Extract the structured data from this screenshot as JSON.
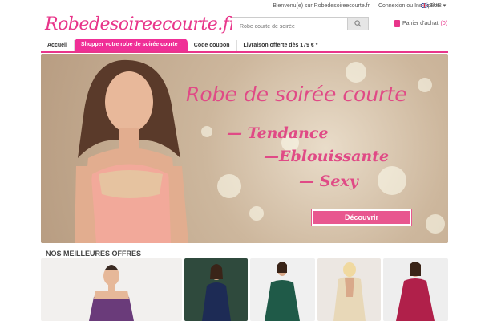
{
  "header": {
    "welcome_link": "Bienvenu(e) sur Robedesoireecourte.fr",
    "login_link": "Connexion ou Inscription",
    "currency": "EUR",
    "logo": "Robedesoireecourte.fr",
    "search_placeholder": "Robe courte de soirée",
    "cart_label": "Panier d'achat",
    "cart_count": "(0)"
  },
  "nav": {
    "items": [
      {
        "label": "Accueil"
      },
      {
        "label": "Shopper votre robe de soirée courte !"
      },
      {
        "label": "Code coupon"
      },
      {
        "label": "Livraison offerte dès 179 € *"
      }
    ],
    "active_index": 1
  },
  "hero": {
    "title": "Robe de soirée courte",
    "tags": [
      "— Tendance",
      "—Eblouissante",
      "— Sexy"
    ],
    "button": "Découvrir"
  },
  "offers": {
    "heading": "NOS MEILLEURES OFFRES"
  },
  "colors": {
    "brand_pink": "#e8358a",
    "nav_active": "#f02f97",
    "button_pink": "#e8578f"
  },
  "icons": [
    "search-icon",
    "flag-icon",
    "cart-icon",
    "caret-down-icon"
  ]
}
